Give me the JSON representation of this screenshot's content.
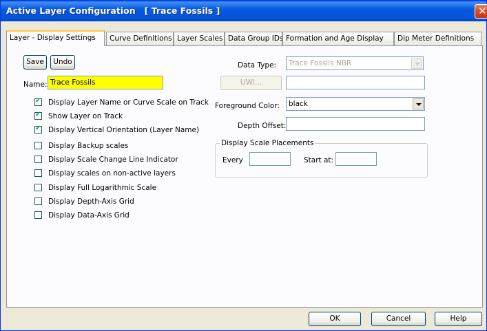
{
  "window": {
    "title": "Active Layer Configuration   [ Trace Fossils ]"
  },
  "tabs": [
    {
      "label": "Layer - Display Settings",
      "active": true
    },
    {
      "label": "Curve Definitions"
    },
    {
      "label": "Layer Scales"
    },
    {
      "label": "Data Group IDs"
    },
    {
      "label": "Formation and Age Display"
    },
    {
      "label": "Dip Meter Definitions"
    }
  ],
  "toolbar": {
    "save_label": "Save",
    "undo_label": "Undo"
  },
  "name_field": {
    "label": "Name:",
    "value": "Trace Fossils"
  },
  "checkboxes": [
    {
      "label": "Display Layer Name or Curve Scale on Track",
      "checked": true
    },
    {
      "label": "Show Layer on Track",
      "checked": true
    },
    {
      "label": "Display Vertical Orientation (Layer Name)",
      "checked": true
    },
    {
      "label": "Display Backup scales",
      "checked": false
    },
    {
      "label": "Display Scale Change Line Indicator",
      "checked": false
    },
    {
      "label": "Display scales on non-active layers",
      "checked": false
    },
    {
      "label": "Display Full Logarithmic Scale",
      "checked": false
    },
    {
      "label": "Display Depth-Axis Grid",
      "checked": false
    },
    {
      "label": "Display Data-Axis Grid",
      "checked": false
    }
  ],
  "data_type": {
    "label": "Data Type:",
    "value": "Trace Fossils NBR"
  },
  "uwi": {
    "button_label": "UWI...",
    "value": ""
  },
  "foreground": {
    "label": "Foreground Color:",
    "value": "black"
  },
  "depth_offset": {
    "label": "Depth Offset:",
    "value": ""
  },
  "scale_placements": {
    "title": "Display Scale Placements",
    "every_label": "Every",
    "every_value": "",
    "start_label": "Start at:",
    "start_value": ""
  },
  "footer": {
    "ok_label": "OK",
    "cancel_label": "Cancel",
    "help_label": "Help"
  },
  "colors": {
    "title_bar": "#0554d8",
    "name_highlight": "#ffff00",
    "active_tab_accent": "#ffc83c"
  }
}
